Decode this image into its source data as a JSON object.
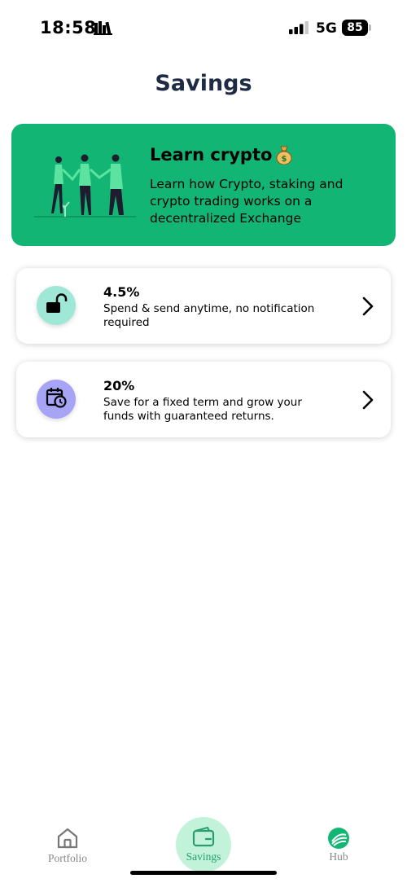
{
  "status_bar": {
    "time": "18:58",
    "network": "5G",
    "battery_level": "85",
    "icons": [
      "focus-icon",
      "signal-icon",
      "battery-icon"
    ]
  },
  "page": {
    "title": "Savings"
  },
  "promo": {
    "title": "Learn crypto",
    "emoji_icon": "moneybag-icon",
    "text": "Learn how Crypto, staking and crypto trading works on a decentralized Exchange",
    "background_color": "#12b574"
  },
  "options": [
    {
      "rate": "4.5%",
      "description": "Spend & send anytime, no notification required",
      "icon": "unlocked-padlock-icon",
      "icon_bg": "#9fe8d8"
    },
    {
      "rate": "20%",
      "description": "Save for a fixed term and grow your funds with guaranteed returns.",
      "icon": "calendar-clock-icon",
      "icon_bg": "#a7a3f5"
    }
  ],
  "bottom_nav": {
    "items": [
      {
        "label": "Portfolio",
        "icon": "home-icon",
        "active": false
      },
      {
        "label": "Savings",
        "icon": "wallet-icon",
        "active": true
      },
      {
        "label": "Hub",
        "icon": "hub-logo-icon",
        "active": false
      }
    ],
    "active_color": "#2a9d6f"
  }
}
